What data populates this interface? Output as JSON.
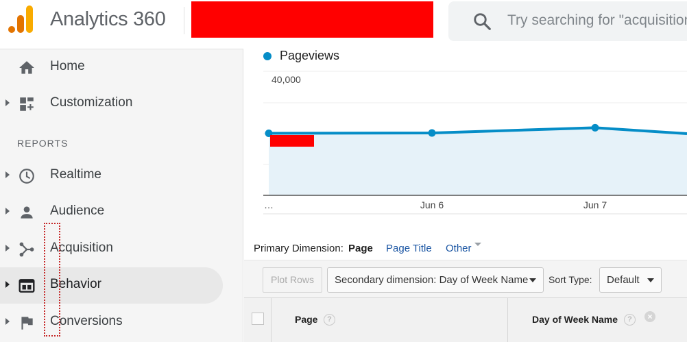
{
  "header": {
    "app_title": "Analytics 360",
    "search_placeholder": "Try searching for \"acquisition\"",
    "brand_colors": {
      "logo_orange": "#f9ab00",
      "logo_dark_orange": "#e37400",
      "redaction": "#ff0000"
    }
  },
  "sidebar": {
    "items_top": [
      {
        "label": "Home",
        "icon": "home-icon",
        "has_caret": false
      },
      {
        "label": "Customization",
        "icon": "dashboard-plus-icon",
        "has_caret": true
      }
    ],
    "reports_header": "REPORTS",
    "reports": [
      {
        "label": "Realtime",
        "icon": "clock-icon",
        "has_caret": true
      },
      {
        "label": "Audience",
        "icon": "person-icon",
        "has_caret": true
      },
      {
        "label": "Acquisition",
        "icon": "acquisition-icon",
        "has_caret": true
      },
      {
        "label": "Behavior",
        "icon": "behavior-window-icon",
        "has_caret": true,
        "active": true
      },
      {
        "label": "Conversions",
        "icon": "flag-icon",
        "has_caret": true
      }
    ]
  },
  "chart_data": {
    "type": "area",
    "series": [
      {
        "name": "Pageviews",
        "color": "#058dc7",
        "values": [
          20000,
          20100,
          21800,
          19900
        ]
      }
    ],
    "categories": [
      "…",
      "Jun 6",
      "Jun 7",
      ""
    ],
    "ylim": [
      0,
      40000
    ],
    "ytick_labels": [
      "40,000"
    ],
    "grid": true
  },
  "primary_dimension": {
    "label": "Primary Dimension:",
    "options": [
      "Page",
      "Page Title",
      "Other"
    ],
    "selected": "Page"
  },
  "toolbar": {
    "plot_rows": "Plot Rows",
    "secondary_dimension": "Secondary dimension: Day of Week Name",
    "sort_label": "Sort Type:",
    "sort_value": "Default"
  },
  "table": {
    "columns": [
      "Page",
      "Day of Week Name"
    ],
    "help_glyph": "?",
    "remove_glyph": "×"
  }
}
